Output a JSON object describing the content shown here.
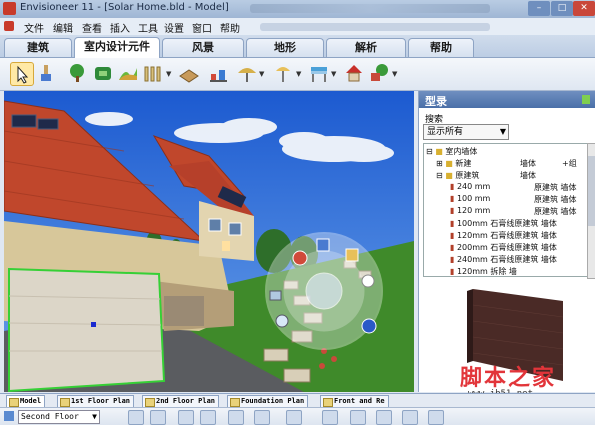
{
  "window": {
    "title": "Envisioneer 11 - [Solar Home.bld - Model]"
  },
  "menu": [
    "文件",
    "编辑",
    "查看",
    "插入",
    "工具",
    "设置",
    "窗口",
    "帮助"
  ],
  "tabs": [
    {
      "label": "建筑",
      "active": false
    },
    {
      "label": "室内设计元件",
      "active": true
    },
    {
      "label": "风景",
      "active": false
    },
    {
      "label": "地形",
      "active": false
    },
    {
      "label": "解析",
      "active": false
    },
    {
      "label": "帮助",
      "active": false
    }
  ],
  "toolbar": {
    "icons": [
      "select-arrow-icon",
      "paint-brush-icon",
      "tree-icon",
      "hedge-icon",
      "terrain-icon",
      "fence-icon",
      "deck-icon",
      "gazebo-icon",
      "umbrella-icon",
      "lamp-icon",
      "awning-icon",
      "birdhouse-icon",
      "garden-icon"
    ]
  },
  "panel": {
    "title": "型录",
    "search_label": "搜索",
    "filter_value": "显示所有",
    "tree": [
      {
        "text": "室内墙体",
        "level": 0,
        "kind": "folder"
      },
      {
        "text": "新建",
        "tag": "墙体",
        "extra": "+组",
        "level": 1,
        "kind": "folder"
      },
      {
        "text": "原建筑",
        "tag": "墙体",
        "level": 1,
        "kind": "folder"
      },
      {
        "text": "240 mm",
        "tag": "原建筑 墙体",
        "level": 2,
        "kind": "wall"
      },
      {
        "text": "100 mm",
        "tag": "原建筑 墙体",
        "level": 2,
        "kind": "wall"
      },
      {
        "text": "120 mm",
        "tag": "原建筑 墙体",
        "level": 2,
        "kind": "wall"
      },
      {
        "text": "100mm 石膏线原建筑 墙体",
        "level": 2,
        "kind": "wall"
      },
      {
        "text": "120mm 石膏线原建筑 墙体",
        "level": 2,
        "kind": "wall"
      },
      {
        "text": "200mm 石膏线原建筑 墙体",
        "level": 2,
        "kind": "wall"
      },
      {
        "text": "240mm 石膏线原建筑 墙体",
        "level": 2,
        "kind": "wall"
      },
      {
        "text": "120mm 拆除 墙",
        "level": 2,
        "kind": "wall"
      }
    ]
  },
  "sheet_tabs": [
    "Model",
    "1st Floor Plan",
    "2nd Floor Plan",
    "Foundation Plan",
    "Front and Re"
  ],
  "bottombar": {
    "floor_value": "Second Floor"
  },
  "watermark": {
    "cn": "脚本之家",
    "url": "www.jb51.net"
  },
  "colors": {
    "title_bg": "#9fb6d4",
    "panel_head": "#4a6fa8",
    "sky": "#2f6fd8",
    "roof": "#c0472c",
    "grass": "#3f8a2a",
    "watermark": "#e2353a"
  }
}
